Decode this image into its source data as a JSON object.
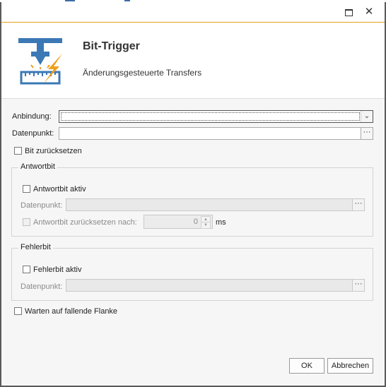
{
  "window": {
    "maximize_icon": "maximize-icon",
    "close_label": "✕"
  },
  "header": {
    "icon": "bit-trigger-icon",
    "title": "Bit-Trigger",
    "subtitle": "Änderungsgesteuerte Transfers"
  },
  "form": {
    "binding_label": "Anbindung:",
    "binding_value": "",
    "datapoint_label": "Datenpunkt:",
    "datapoint_value": "",
    "browse_label": "···",
    "reset_bit_label": "Bit zurücksetzen",
    "reset_bit_checked": false
  },
  "response_group": {
    "title": "Antwortbit",
    "active_label": "Antwortbit aktiv",
    "active_checked": false,
    "datapoint_label": "Datenpunkt:",
    "datapoint_value": "",
    "reset_after_label": "Antwortbit zurücksetzen nach:",
    "reset_after_value": "0",
    "unit": "ms"
  },
  "error_group": {
    "title": "Fehlerbit",
    "active_label": "Fehlerbit aktiv",
    "active_checked": false,
    "datapoint_label": "Datenpunkt:",
    "datapoint_value": ""
  },
  "falling_edge_label": "Warten auf fallende Flanke",
  "falling_edge_checked": false,
  "buttons": {
    "ok": "OK",
    "cancel": "Abbrechen"
  },
  "colors": {
    "accent": "#e3a21a",
    "icon_blue": "#3b78b5",
    "icon_orange": "#f0a020"
  }
}
